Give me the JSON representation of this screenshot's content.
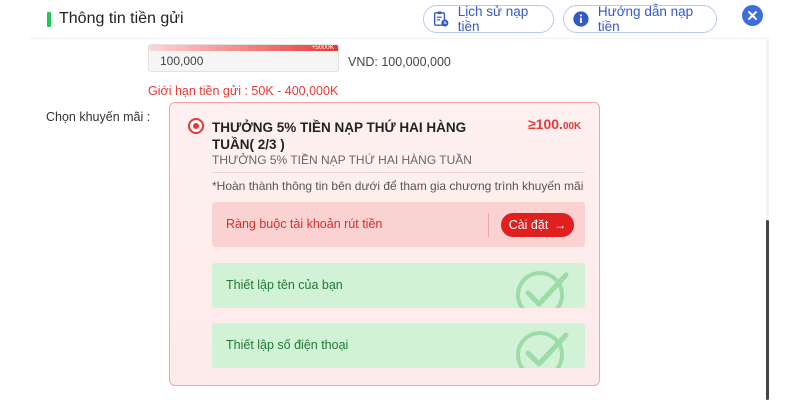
{
  "header": {
    "title": "Thông tin tiền gửi",
    "history_label": "Lịch sử nạp tiền",
    "guide_label": "Hướng dẫn nạp tiền"
  },
  "deposit": {
    "amount_value": "100,000",
    "quick_add_label": "+5000K",
    "vnd_text": "VND: 100,000,000",
    "limit_text": "Giới hạn tiền gửi :  50K  -  400,000K"
  },
  "promo": {
    "section_label": "Chọn khuyến mãi :",
    "title": "THƯỞNG 5% TIỀN NẠP THỨ HAI HÀNG TUẦN( 2/3 )",
    "amount_main": "≥100.",
    "amount_small": "00K",
    "subtitle": "THƯỞNG 5% TIỀN NẠP THỨ HAI HÀNG TUẦN",
    "note": "*Hoàn thành thông tin bên dưới để tham gia chương trình khuyến mãi",
    "tasks": [
      {
        "label": "Ràng buộc tài khoản rút tiền",
        "button": "Cài đặt",
        "status": "pending"
      },
      {
        "label": "Thiết lập tên của bạn",
        "status": "done"
      },
      {
        "label": "Thiết lập số điện thoại",
        "status": "done"
      }
    ]
  },
  "colors": {
    "accent_red": "#e53935",
    "accent_blue": "#3559c7",
    "green": "#22c55e"
  }
}
